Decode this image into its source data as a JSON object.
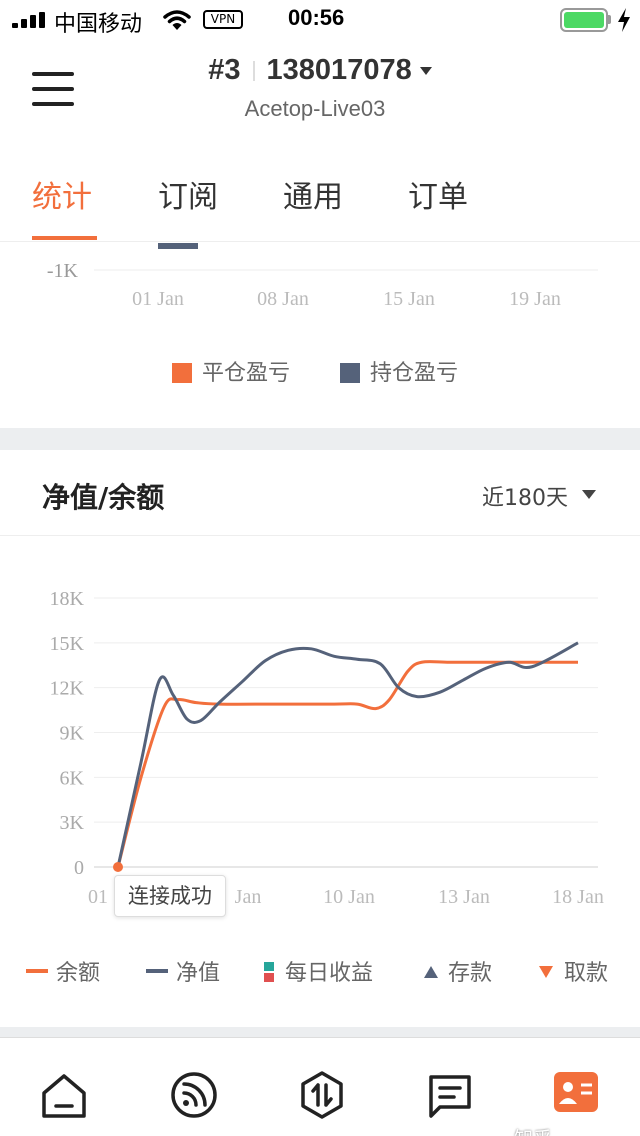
{
  "status_bar": {
    "carrier": "中国移动",
    "vpn": "VPN",
    "time": "00:56",
    "battery_color": "#4cd964"
  },
  "header": {
    "account_prefix": "#3",
    "account_number": "138017078",
    "server": "Acetop-Live03",
    "menu_icon": "hamburger-menu-icon"
  },
  "tabs": [
    {
      "label": "统计",
      "active": true
    },
    {
      "label": "订阅",
      "active": false
    },
    {
      "label": "通用",
      "active": false
    },
    {
      "label": "订单",
      "active": false
    }
  ],
  "pnl_chart": {
    "y_tick_visible": "-1K",
    "x_ticks": [
      "01 Jan",
      "08 Jan",
      "15 Jan",
      "19 Jan"
    ],
    "legend": [
      {
        "label": "平仓盈亏",
        "color": "#f26f3c"
      },
      {
        "label": "持仓盈亏",
        "color": "#55627a"
      }
    ]
  },
  "equity_card": {
    "title": "净值/余额",
    "range": "近180天",
    "tooltip": "连接成功",
    "legend": [
      {
        "label": "余额",
        "color": "#f26f3c",
        "icon": "line-swatch-icon"
      },
      {
        "label": "净值",
        "color": "#55627a",
        "icon": "line-swatch-icon"
      },
      {
        "label": "每日收益",
        "colors": [
          "#26a69a",
          "#e05050"
        ],
        "icon": "daily-profit-swatch-icon"
      },
      {
        "label": "存款",
        "color": "#55627a",
        "icon": "triangle-up-icon"
      },
      {
        "label": "取款",
        "color": "#f26f3c",
        "icon": "triangle-down-icon"
      }
    ]
  },
  "chart_data": {
    "type": "line",
    "title": "净值/余额",
    "x_tick_labels": [
      "01",
      "Jan",
      "10 Jan",
      "13 Jan",
      "18 Jan"
    ],
    "y_tick_labels": [
      "0",
      "3K",
      "6K",
      "9K",
      "12K",
      "15K",
      "18K"
    ],
    "ylim": [
      0,
      18000
    ],
    "grid": true,
    "legend_position": "bottom",
    "series": [
      {
        "name": "余额",
        "color": "#f26f3c",
        "x": [
          0,
          0.5,
          1,
          1.3,
          1.7,
          2.2,
          3.5,
          4.7,
          5.2,
          5.6,
          5.9,
          6.3,
          6.6,
          7.2,
          8.0,
          9.0,
          10.0
        ],
        "values": [
          0,
          6000,
          10700,
          11200,
          11000,
          10900,
          10900,
          10900,
          10900,
          10600,
          11200,
          13100,
          13700,
          13700,
          13700,
          13700,
          13700
        ]
      },
      {
        "name": "净值",
        "color": "#55627a",
        "x": [
          0,
          0.5,
          0.9,
          1.2,
          1.5,
          1.8,
          2.2,
          2.7,
          3.2,
          3.7,
          4.2,
          4.7,
          5.2,
          5.7,
          6.1,
          6.5,
          7.0,
          7.5,
          8.0,
          8.5,
          9.0,
          10.0
        ],
        "values": [
          0,
          7000,
          12500,
          11500,
          9900,
          9800,
          11000,
          12400,
          13800,
          14500,
          14600,
          14100,
          13900,
          13600,
          12000,
          11400,
          11700,
          12500,
          13300,
          13700,
          13400,
          15000
        ]
      }
    ],
    "markers": [
      {
        "type": "point",
        "x": 0,
        "value": 0,
        "color": "#f26f3c"
      }
    ]
  },
  "bottom_nav": {
    "items": [
      {
        "name": "home-icon"
      },
      {
        "name": "signal-feed-icon"
      },
      {
        "name": "trade-icon"
      },
      {
        "name": "messages-icon"
      },
      {
        "name": "profile-icon"
      }
    ],
    "watermark": "知乎 @XinNuo"
  }
}
